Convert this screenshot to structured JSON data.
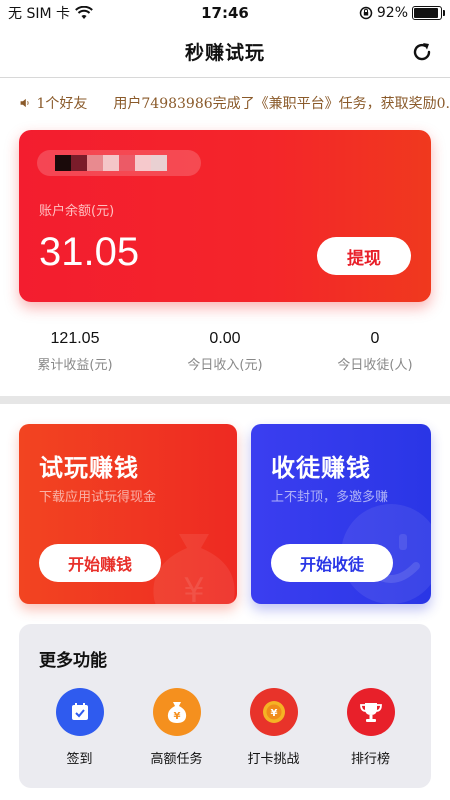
{
  "status_bar": {
    "carrier": "无 SIM 卡",
    "time": "17:46",
    "battery_percent": "92%",
    "battery_level": 0.92
  },
  "nav": {
    "title": "秒赚试玩",
    "refresh_icon": "refresh-icon"
  },
  "notice": {
    "friends": "1个好友",
    "message": "用户74983986完成了《兼职平台》任务，获取奖励0."
  },
  "balance_card": {
    "label": "账户余额(元)",
    "amount": "31.05",
    "withdraw_label": "提现"
  },
  "stats": [
    {
      "value": "121.05",
      "label": "累计收益(元)"
    },
    {
      "value": "0.00",
      "label": "今日收入(元)"
    },
    {
      "value": "0",
      "label": "今日收徒(人)"
    }
  ],
  "promos": {
    "trial": {
      "title": "试玩赚钱",
      "subtitle": "下载应用试玩得现金",
      "button": "开始赚钱"
    },
    "recruit": {
      "title": "收徒赚钱",
      "subtitle": "上不封顶，多邀多赚",
      "button": "开始收徒"
    }
  },
  "features": {
    "title": "更多功能",
    "items": [
      {
        "label": "签到",
        "icon": "calendar-check-icon",
        "color": "#2f5bef"
      },
      {
        "label": "高额任务",
        "icon": "money-bag-icon",
        "color": "#f5901e"
      },
      {
        "label": "打卡挑战",
        "icon": "coin-badge-icon",
        "color": "#e8332a"
      },
      {
        "label": "排行榜",
        "icon": "trophy-icon",
        "color": "#e8202a"
      }
    ]
  },
  "colors": {
    "balance_card": "#f31d2f",
    "trial_card": "#f24421",
    "recruit_card": "#2a36e6",
    "notice_text": "#8a5a2a"
  }
}
